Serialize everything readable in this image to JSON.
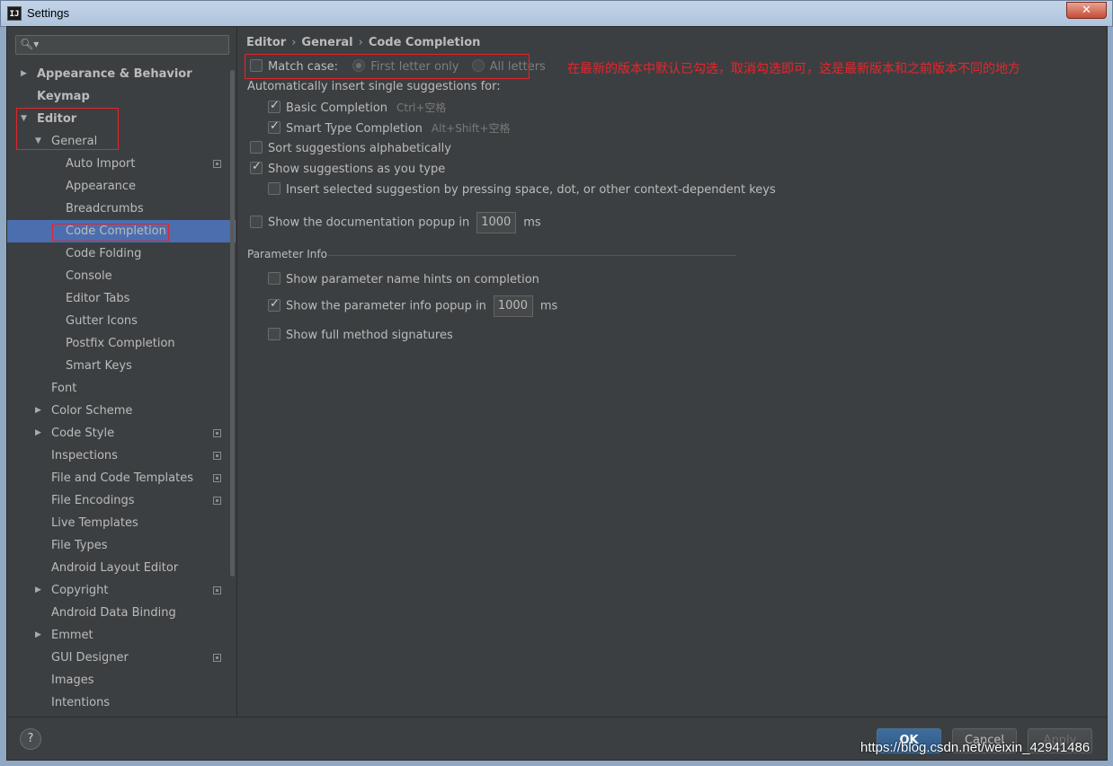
{
  "window": {
    "title": "Settings",
    "app_icon_text": "IJ",
    "close": "✕"
  },
  "search": {
    "placeholder": "",
    "icon": "search-icon"
  },
  "sidebar": {
    "items": [
      {
        "label": "Appearance & Behavior",
        "arrow": "▶",
        "level": 0,
        "bold": true
      },
      {
        "label": "Keymap",
        "level": 0,
        "bold": true
      },
      {
        "label": "Editor",
        "arrow": "▼",
        "level": 0,
        "bold": true
      },
      {
        "label": "General",
        "arrow": "▼",
        "level": 1
      },
      {
        "label": "Auto Import",
        "level": 2,
        "project": true
      },
      {
        "label": "Appearance",
        "level": 2
      },
      {
        "label": "Breadcrumbs",
        "level": 2
      },
      {
        "label": "Code Completion",
        "level": 2,
        "selected": true
      },
      {
        "label": "Code Folding",
        "level": 2
      },
      {
        "label": "Console",
        "level": 2
      },
      {
        "label": "Editor Tabs",
        "level": 2
      },
      {
        "label": "Gutter Icons",
        "level": 2
      },
      {
        "label": "Postfix Completion",
        "level": 2
      },
      {
        "label": "Smart Keys",
        "level": 2
      },
      {
        "label": "Font",
        "level": 1
      },
      {
        "label": "Color Scheme",
        "arrow": "▶",
        "level": 1
      },
      {
        "label": "Code Style",
        "arrow": "▶",
        "level": 1,
        "project": true
      },
      {
        "label": "Inspections",
        "level": 1,
        "project": true
      },
      {
        "label": "File and Code Templates",
        "level": 1,
        "project": true
      },
      {
        "label": "File Encodings",
        "level": 1,
        "project": true
      },
      {
        "label": "Live Templates",
        "level": 1
      },
      {
        "label": "File Types",
        "level": 1
      },
      {
        "label": "Android Layout Editor",
        "level": 1
      },
      {
        "label": "Copyright",
        "arrow": "▶",
        "level": 1,
        "project": true
      },
      {
        "label": "Android Data Binding",
        "level": 1
      },
      {
        "label": "Emmet",
        "arrow": "▶",
        "level": 1
      },
      {
        "label": "GUI Designer",
        "level": 1,
        "project": true
      },
      {
        "label": "Images",
        "level": 1
      },
      {
        "label": "Intentions",
        "level": 1
      }
    ]
  },
  "breadcrumb": {
    "parts": [
      "Editor",
      "General",
      "Code Completion"
    ],
    "separator": "›"
  },
  "completion": {
    "match_case_label": "Match case:",
    "match_case_checked": false,
    "first_letter_label": "First letter only",
    "all_letters_label": "All letters",
    "auto_insert_label": "Automatically insert single suggestions for:",
    "basic_label": "Basic Completion",
    "basic_shortcut": "Ctrl+空格",
    "smart_label": "Smart Type Completion",
    "smart_shortcut": "Alt+Shift+空格",
    "sort_label": "Sort suggestions alphabetically",
    "show_as_type_label": "Show suggestions as you type",
    "insert_selected_label": "Insert selected suggestion by pressing space, dot, or other context-dependent keys",
    "doc_popup_label": "Show the documentation popup in",
    "doc_popup_value": "1000",
    "ms": "ms"
  },
  "param_info": {
    "section_title": "Parameter Info",
    "name_hints_label": "Show parameter name hints on completion",
    "info_popup_label": "Show the parameter info popup in",
    "info_popup_value": "1000",
    "ms": "ms",
    "full_signatures_label": "Show full method signatures"
  },
  "annotation": {
    "text": "在最新的版本中默认已勾选，取消勾选即可，这是最新版本和之前版本不同的地方",
    "color": "#e6262c"
  },
  "buttons": {
    "help": "?",
    "ok": "OK",
    "cancel": "Cancel",
    "apply": "Apply"
  },
  "watermark": "https://blog.csdn.net/weixin_42941486",
  "colors": {
    "background": "#3c3f41",
    "selection": "#4b6eaf",
    "annotation_red": "#e0262b"
  }
}
